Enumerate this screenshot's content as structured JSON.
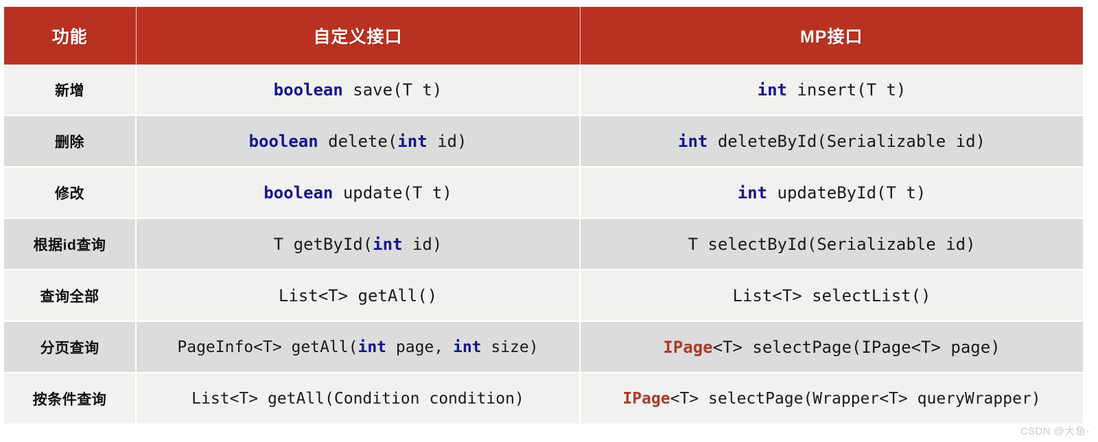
{
  "table": {
    "headers": [
      {
        "label": "功能",
        "name": "feature"
      },
      {
        "label": "自定义接口",
        "name": "custom-interface"
      },
      {
        "label": "MP接口",
        "name": "mp-interface"
      }
    ],
    "rows": [
      {
        "feature": "新增",
        "custom_plain": "boolean save(T t)",
        "mp_plain": "int insert(T t)"
      },
      {
        "feature": "删除",
        "custom_plain": "boolean delete(int id)",
        "mp_plain": "int deleteById(Serializable id)"
      },
      {
        "feature": "修改",
        "custom_plain": "boolean update(T t)",
        "mp_plain": "int updateById(T t)"
      },
      {
        "feature": "根据id查询",
        "custom_plain": "T getById(int id)",
        "mp_plain": "T selectById(Serializable id)"
      },
      {
        "feature": "查询全部",
        "custom_plain": "List<T> getAll()",
        "mp_plain": "List<T> selectList()"
      },
      {
        "feature": "分页查询",
        "custom_plain": "PageInfo<T> getAll(int page, int size)",
        "mp_plain": "IPage<T> selectPage(IPage<T> page)"
      },
      {
        "feature": "按条件查询",
        "custom_plain": "List<T> getAll(Condition condition)",
        "mp_plain": "IPage<T> selectPage(Wrapper<T> queryWrapper)"
      }
    ],
    "code_tokens": {
      "custom": [
        [
          {
            "t": "boolean",
            "c": "kw"
          },
          {
            "t": " save(T t)",
            "c": ""
          }
        ],
        [
          {
            "t": "boolean",
            "c": "kw"
          },
          {
            "t": " delete(",
            "c": ""
          },
          {
            "t": "int",
            "c": "kw"
          },
          {
            "t": " id)",
            "c": ""
          }
        ],
        [
          {
            "t": "boolean",
            "c": "kw"
          },
          {
            "t": " update(T t)",
            "c": ""
          }
        ],
        [
          {
            "t": "T getById(",
            "c": ""
          },
          {
            "t": "int",
            "c": "kw"
          },
          {
            "t": " id)",
            "c": ""
          }
        ],
        [
          {
            "t": "List<T> getAll()",
            "c": ""
          }
        ],
        [
          {
            "t": "PageInfo<T> getAll(",
            "c": ""
          },
          {
            "t": "int",
            "c": "kw"
          },
          {
            "t": " page, ",
            "c": ""
          },
          {
            "t": "int",
            "c": "kw"
          },
          {
            "t": " size)",
            "c": ""
          }
        ],
        [
          {
            "t": "List<T> getAll(Condition condition)",
            "c": ""
          }
        ]
      ],
      "mp": [
        [
          {
            "t": "int",
            "c": "kw"
          },
          {
            "t": " insert(T t)",
            "c": ""
          }
        ],
        [
          {
            "t": "int",
            "c": "kw"
          },
          {
            "t": " deleteById(Serializable id)",
            "c": ""
          }
        ],
        [
          {
            "t": "int",
            "c": "kw"
          },
          {
            "t": " updateById(T t)",
            "c": ""
          }
        ],
        [
          {
            "t": "T selectById(Serializable id)",
            "c": ""
          }
        ],
        [
          {
            "t": "List<T> selectList()",
            "c": ""
          }
        ],
        [
          {
            "t": "IPage",
            "c": "ipage"
          },
          {
            "t": "<T> selectPage(IPage<T> page)",
            "c": ""
          }
        ],
        [
          {
            "t": "IPage",
            "c": "ipage"
          },
          {
            "t": "<T> selectPage(Wrapper<T> queryWrapper)",
            "c": ""
          }
        ]
      ]
    },
    "row_styles": [
      "row-light",
      "row-dark",
      "row-light",
      "row-dark",
      "row-light",
      "row-dark",
      "row-light"
    ]
  },
  "watermark": {
    "text": "CSDN @大鱼-"
  },
  "colors": {
    "header_bg": "#b93221",
    "row_light": "#f1f1ef",
    "row_dark": "#dcdcdc",
    "keyword": "#15158c",
    "ipage": "#ab3a2a",
    "header_text": "#ffffff"
  }
}
